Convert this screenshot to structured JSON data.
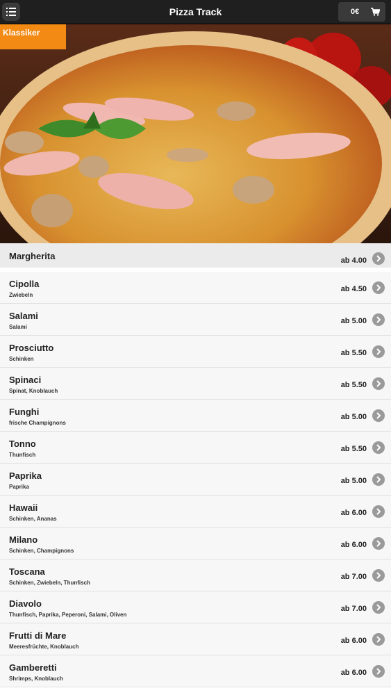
{
  "header": {
    "title": "Pizza Track",
    "cart_total": "0€",
    "menu_icon": "list-icon",
    "cart_icon": "shopping-cart-icon"
  },
  "category": {
    "label": "Klassiker"
  },
  "menu": {
    "items": [
      {
        "name": "Margherita",
        "desc": "",
        "price": "ab 4.00"
      },
      {
        "name": "Cipolla",
        "desc": "Zwiebeln",
        "price": "ab 4.50"
      },
      {
        "name": "Salami",
        "desc": "Salami",
        "price": "ab 5.00"
      },
      {
        "name": "Prosciutto",
        "desc": "Schinken",
        "price": "ab 5.50"
      },
      {
        "name": "Spinaci",
        "desc": "Spinat, Knoblauch",
        "price": "ab 5.50"
      },
      {
        "name": "Funghi",
        "desc": "frische Champignons",
        "price": "ab 5.00"
      },
      {
        "name": "Tonno",
        "desc": "Thunfisch",
        "price": "ab 5.50"
      },
      {
        "name": "Paprika",
        "desc": "Paprika",
        "price": "ab 5.00"
      },
      {
        "name": "Hawaii",
        "desc": "Schinken, Ananas",
        "price": "ab 6.00"
      },
      {
        "name": "Milano",
        "desc": "Schinken, Champignons",
        "price": "ab 6.00"
      },
      {
        "name": "Toscana",
        "desc": "Schinken, Zwiebeln, Thunfisch",
        "price": "ab 7.00"
      },
      {
        "name": "Diavolo",
        "desc": "Thunfisch, Paprika, Peperoni, Salami, Oliven",
        "price": "ab 7.00"
      },
      {
        "name": "Frutti di Mare",
        "desc": "Meeresfrüchte, Knoblauch",
        "price": "ab 6.00"
      },
      {
        "name": "Gamberetti",
        "desc": "Shrimps, Knoblauch",
        "price": "ab 6.00"
      }
    ]
  }
}
